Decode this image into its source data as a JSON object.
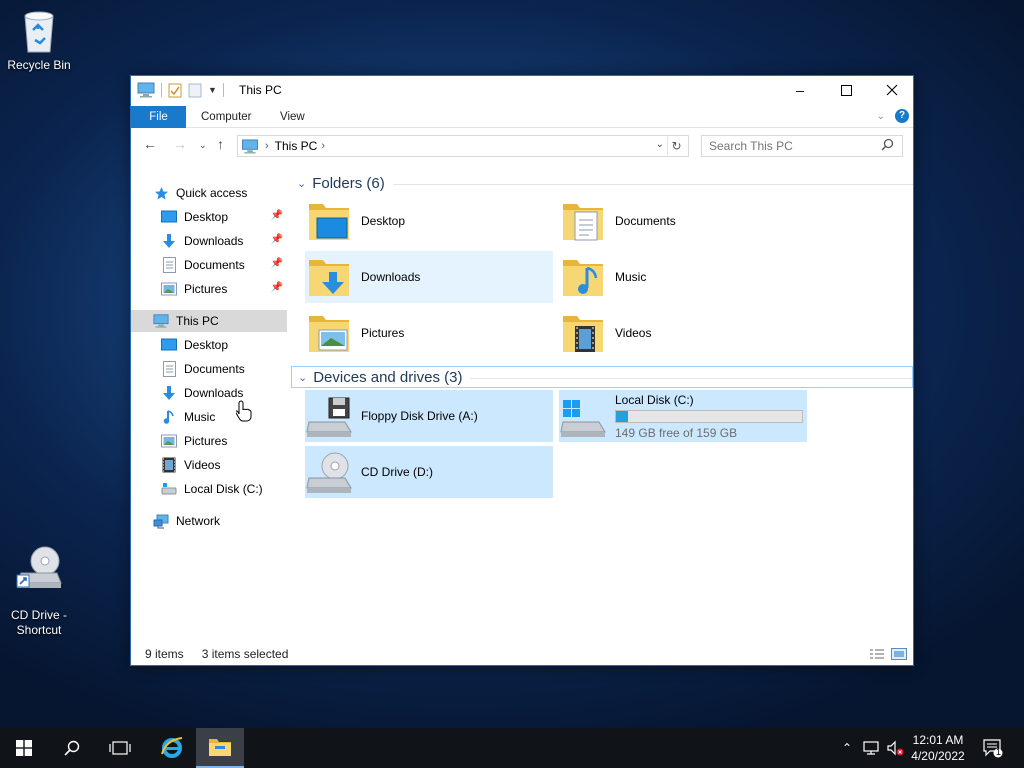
{
  "desktop": {
    "icons": [
      {
        "label": "Recycle Bin",
        "icon": "recycle-bin-icon"
      },
      {
        "label": "CD Drive -\nShortcut",
        "icon": "cd-drive-shortcut-icon"
      }
    ]
  },
  "window": {
    "title": "This PC",
    "ribbon_tabs": [
      "File",
      "Computer",
      "View"
    ],
    "address": {
      "crumb": "This PC"
    },
    "search": {
      "placeholder": "Search This PC"
    },
    "sidebar": {
      "quick_access": "Quick access",
      "quick_items": [
        {
          "label": "Desktop",
          "icon": "desktop-icon",
          "pinned": true
        },
        {
          "label": "Downloads",
          "icon": "downloads-icon",
          "pinned": true
        },
        {
          "label": "Documents",
          "icon": "documents-icon",
          "pinned": true
        },
        {
          "label": "Pictures",
          "icon": "pictures-icon",
          "pinned": true
        }
      ],
      "this_pc": "This PC",
      "pc_items": [
        {
          "label": "Desktop",
          "icon": "desktop-icon"
        },
        {
          "label": "Documents",
          "icon": "documents-icon"
        },
        {
          "label": "Downloads",
          "icon": "downloads-icon"
        },
        {
          "label": "Music",
          "icon": "music-icon"
        },
        {
          "label": "Pictures",
          "icon": "pictures-icon"
        },
        {
          "label": "Videos",
          "icon": "videos-icon"
        },
        {
          "label": "Local Disk (C:)",
          "icon": "local-disk-icon"
        }
      ],
      "network": "Network"
    },
    "folders_header": "Folders (6)",
    "folders": [
      {
        "label": "Desktop",
        "icon": "desktop-folder-icon"
      },
      {
        "label": "Documents",
        "icon": "documents-folder-icon"
      },
      {
        "label": "Downloads",
        "icon": "downloads-folder-icon"
      },
      {
        "label": "Music",
        "icon": "music-folder-icon"
      },
      {
        "label": "Pictures",
        "icon": "pictures-folder-icon"
      },
      {
        "label": "Videos",
        "icon": "videos-folder-icon"
      }
    ],
    "drives_header": "Devices and drives (3)",
    "drives": [
      {
        "label": "Floppy Disk Drive (A:)",
        "icon": "floppy-drive-icon"
      },
      {
        "label": "Local Disk (C:)",
        "icon": "local-disk-icon",
        "free_text": "149 GB free of 159 GB",
        "used_fraction": 0.063
      },
      {
        "label": "CD Drive (D:)",
        "icon": "cd-drive-icon"
      }
    ],
    "status": {
      "items": "9 items",
      "selected": "3 items selected"
    }
  },
  "taskbar": {
    "clock_time": "12:01 AM",
    "clock_date": "4/20/2022",
    "notification_count": "1"
  },
  "colors": {
    "accent": "#1979ca",
    "selected": "#cce8ff",
    "hover": "#e5f3ff",
    "folder": "#f3c654"
  }
}
